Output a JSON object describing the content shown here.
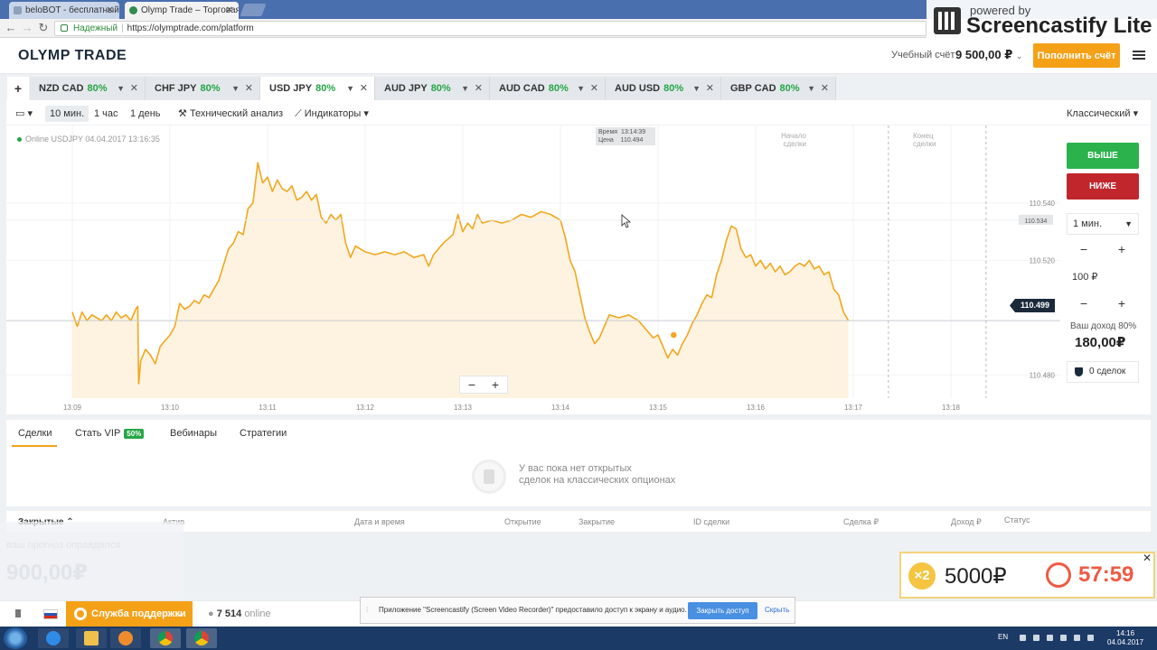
{
  "browser": {
    "tabs": [
      {
        "title": "beloBOT - бесплатный р"
      },
      {
        "title": "Olymp Trade – Торговая"
      }
    ],
    "secure_label": "Надежный",
    "url": "https://olymptrade.com/platform"
  },
  "watermark": {
    "line1": "powered by",
    "line2": "Screencastify Lite"
  },
  "header": {
    "logo": "OLYMP TRADE",
    "account_label": "Учебный счёт",
    "account_value": "9 500,00 ₽",
    "deposit_button": "Пополнить счёт"
  },
  "assets": [
    {
      "name": "NZD CAD",
      "pct": "80%"
    },
    {
      "name": "CHF JPY",
      "pct": "80%"
    },
    {
      "name": "USD JPY",
      "pct": "80%"
    },
    {
      "name": "AUD JPY",
      "pct": "80%"
    },
    {
      "name": "AUD CAD",
      "pct": "80%"
    },
    {
      "name": "AUD USD",
      "pct": "80%"
    },
    {
      "name": "GBP CAD",
      "pct": "80%"
    }
  ],
  "toolbar": {
    "tf_10m": "10 мин.",
    "tf_1h": "1 час",
    "tf_1d": "1 день",
    "tech": "Технический анализ",
    "indicators": "Индикаторы",
    "mode": "Классический"
  },
  "chart": {
    "online": "Online USDJPY 04.04.2017 13:16:35",
    "tip_time_label": "Время",
    "tip_time": "13:14:39",
    "tip_price_label": "Цена",
    "tip_price": "110.494",
    "deal_start": [
      "Начало",
      "сделки"
    ],
    "deal_end": [
      "Конец",
      "сделки"
    ],
    "current_price": "110.499",
    "hover_price": "110.534"
  },
  "chart_data": {
    "type": "area",
    "title": "",
    "x_ticks": [
      "13:09",
      "13:10",
      "13:11",
      "13:12",
      "13:13",
      "13:14",
      "13:15",
      "13:16",
      "13:17",
      "13:18"
    ],
    "y_ticks": [
      "110.540",
      "110.520",
      "110.480"
    ],
    "ylim": [
      110.472,
      110.567
    ],
    "grid": true,
    "color": "#f2a71f",
    "fill": "#fdf3e0",
    "series": [
      {
        "values": [
          [
            0,
            110.502
          ],
          [
            0.05,
            110.497
          ],
          [
            0.1,
            110.502
          ],
          [
            0.15,
            110.499
          ],
          [
            0.2,
            110.501
          ],
          [
            0.25,
            110.5
          ],
          [
            0.3,
            110.499
          ],
          [
            0.35,
            110.501
          ],
          [
            0.4,
            110.499
          ],
          [
            0.45,
            110.502
          ],
          [
            0.5,
            110.5
          ],
          [
            0.55,
            110.501
          ],
          [
            0.6,
            110.499
          ],
          [
            0.65,
            110.503
          ],
          [
            0.67,
            110.504
          ],
          [
            0.68,
            110.477
          ],
          [
            0.7,
            110.485
          ],
          [
            0.75,
            110.489
          ],
          [
            0.8,
            110.487
          ],
          [
            0.85,
            110.484
          ],
          [
            0.9,
            110.49
          ],
          [
            0.95,
            110.492
          ],
          [
            1.0,
            110.494
          ],
          [
            1.05,
            110.497
          ],
          [
            1.1,
            110.505
          ],
          [
            1.15,
            110.503
          ],
          [
            1.2,
            110.504
          ],
          [
            1.25,
            110.506
          ],
          [
            1.3,
            110.505
          ],
          [
            1.35,
            110.508
          ],
          [
            1.4,
            110.507
          ],
          [
            1.5,
            110.513
          ],
          [
            1.6,
            110.524
          ],
          [
            1.65,
            110.526
          ],
          [
            1.7,
            110.53
          ],
          [
            1.75,
            110.529
          ],
          [
            1.8,
            110.538
          ],
          [
            1.85,
            110.54
          ],
          [
            1.9,
            110.554
          ],
          [
            1.95,
            110.547
          ],
          [
            2.0,
            110.549
          ],
          [
            2.05,
            110.544
          ],
          [
            2.1,
            110.548
          ],
          [
            2.15,
            110.545
          ],
          [
            2.2,
            110.544
          ],
          [
            2.25,
            110.546
          ],
          [
            2.3,
            110.541
          ],
          [
            2.35,
            110.542
          ],
          [
            2.4,
            110.544
          ],
          [
            2.45,
            110.541
          ],
          [
            2.5,
            110.543
          ],
          [
            2.55,
            110.535
          ],
          [
            2.6,
            110.533
          ],
          [
            2.65,
            110.536
          ],
          [
            2.7,
            110.534
          ],
          [
            2.75,
            110.536
          ],
          [
            2.8,
            110.526
          ],
          [
            2.85,
            110.521
          ],
          [
            2.9,
            110.525
          ],
          [
            2.95,
            110.524
          ],
          [
            3.0,
            110.523
          ],
          [
            3.1,
            110.522
          ],
          [
            3.2,
            110.523
          ],
          [
            3.3,
            110.522
          ],
          [
            3.4,
            110.523
          ],
          [
            3.5,
            110.521
          ],
          [
            3.6,
            110.522
          ],
          [
            3.65,
            110.518
          ],
          [
            3.7,
            110.522
          ],
          [
            3.8,
            110.526
          ],
          [
            3.9,
            110.529
          ],
          [
            3.95,
            110.536
          ],
          [
            4.0,
            110.53
          ],
          [
            4.05,
            110.533
          ],
          [
            4.1,
            110.531
          ],
          [
            4.15,
            110.536
          ],
          [
            4.2,
            110.533
          ],
          [
            4.3,
            110.534
          ],
          [
            4.4,
            110.533
          ],
          [
            4.5,
            110.534
          ],
          [
            4.6,
            110.536
          ],
          [
            4.7,
            110.535
          ],
          [
            4.8,
            110.537
          ],
          [
            4.9,
            110.536
          ],
          [
            5.0,
            110.534
          ],
          [
            5.05,
            110.528
          ],
          [
            5.1,
            110.52
          ],
          [
            5.15,
            110.516
          ],
          [
            5.2,
            110.508
          ],
          [
            5.25,
            110.5
          ],
          [
            5.3,
            110.495
          ],
          [
            5.35,
            110.491
          ],
          [
            5.4,
            110.493
          ],
          [
            5.45,
            110.497
          ],
          [
            5.5,
            110.501
          ],
          [
            5.6,
            110.5
          ],
          [
            5.7,
            110.501
          ],
          [
            5.8,
            110.499
          ],
          [
            5.9,
            110.495
          ],
          [
            5.95,
            110.493
          ],
          [
            6.0,
            110.494
          ],
          [
            6.05,
            110.49
          ],
          [
            6.1,
            110.486
          ],
          [
            6.15,
            110.489
          ],
          [
            6.2,
            110.487
          ],
          [
            6.25,
            110.491
          ],
          [
            6.3,
            110.494
          ],
          [
            6.35,
            110.498
          ],
          [
            6.4,
            110.501
          ],
          [
            6.45,
            110.505
          ],
          [
            6.5,
            110.508
          ],
          [
            6.55,
            110.507
          ],
          [
            6.6,
            110.515
          ],
          [
            6.65,
            110.52
          ],
          [
            6.7,
            110.527
          ],
          [
            6.75,
            110.532
          ],
          [
            6.8,
            110.531
          ],
          [
            6.85,
            110.524
          ],
          [
            6.9,
            110.521
          ],
          [
            6.95,
            110.522
          ],
          [
            7.0,
            110.518
          ],
          [
            7.05,
            110.52
          ],
          [
            7.1,
            110.517
          ],
          [
            7.15,
            110.519
          ],
          [
            7.2,
            110.516
          ],
          [
            7.25,
            110.518
          ],
          [
            7.3,
            110.515
          ],
          [
            7.35,
            110.516
          ],
          [
            7.4,
            110.518
          ],
          [
            7.45,
            110.519
          ],
          [
            7.5,
            110.518
          ],
          [
            7.55,
            110.52
          ],
          [
            7.6,
            110.517
          ],
          [
            7.65,
            110.518
          ],
          [
            7.7,
            110.515
          ],
          [
            7.75,
            110.516
          ],
          [
            7.8,
            110.51
          ],
          [
            7.85,
            110.508
          ],
          [
            7.9,
            110.502
          ],
          [
            7.95,
            110.499
          ]
        ]
      }
    ],
    "markers": [
      {
        "x": 6.16,
        "y": 110.494,
        "label": "hover"
      }
    ],
    "vlines": [
      {
        "x": 8.36,
        "label": "deal_start"
      },
      {
        "x": 9.36,
        "label": "deal_end"
      }
    ]
  },
  "panel": {
    "up": "ВЫШЕ",
    "down": "НИЖЕ",
    "duration": "1 мин.",
    "amount": "100 ₽",
    "income_label": "Ваш доход 80%",
    "income_value": "180,00₽",
    "deals": "0 сделок"
  },
  "deals": {
    "tab_deals": "Сделки",
    "tab_vip": "Стать VIP",
    "vip_badge": "50%",
    "tab_webinars": "Вебинары",
    "tab_strategies": "Стратегии",
    "empty_line1": "У вас пока нет открытых",
    "empty_line2": "сделок на классических опционах"
  },
  "closed": {
    "title": "Закрытые",
    "asset": "Актив",
    "datetime": "Дата и время",
    "open": "Открытие",
    "close": "Закрытие",
    "deal_id": "ID сделки",
    "deal": "Сделка ₽",
    "income": "Доход ₽",
    "status": "Статус"
  },
  "ghost": {
    "text": "ваш прогноз оправдался",
    "value": "900,00₽"
  },
  "promo": {
    "mult": "×2",
    "amount": "5000₽",
    "timer": "57:59"
  },
  "footer": {
    "support": "Служба поддержки",
    "online_count": "7 514",
    "online_label": "online"
  },
  "share": {
    "message": "Приложение \"Screencastify (Screen Video Recorder)\" предоставило доступ к экрану и аудио.",
    "stop": "Закрыть доступ",
    "hide": "Скрыть"
  },
  "taskbar": {
    "lang": "EN",
    "time": "14:16",
    "date": "04.04.2017"
  }
}
